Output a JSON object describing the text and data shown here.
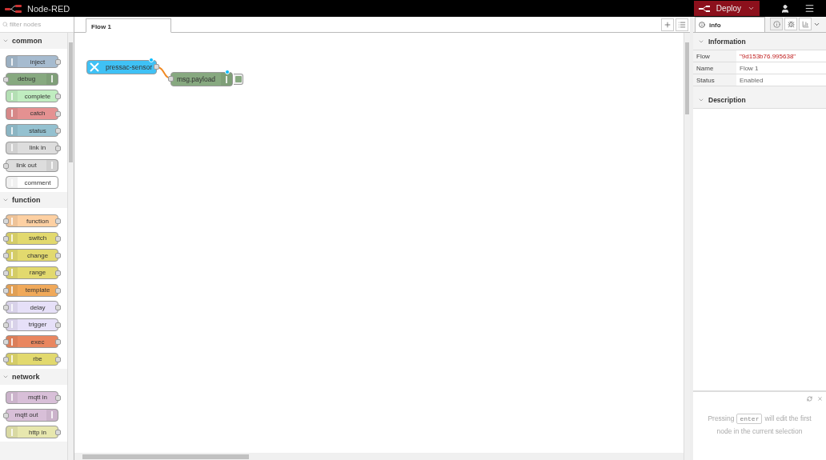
{
  "header": {
    "title": "Node-RED",
    "deploy": "Deploy"
  },
  "palette": {
    "filter_placeholder": "filter nodes",
    "categories": [
      {
        "name": "common",
        "expanded": true,
        "nodes": [
          {
            "label": "inject",
            "color": "#a6bbcf",
            "input": false,
            "output": true,
            "icon_right": false
          },
          {
            "label": "debug",
            "color": "#87a980",
            "input": true,
            "output": false,
            "icon_right": true
          },
          {
            "label": "complete",
            "color": "#c0edc0",
            "input": false,
            "output": true,
            "icon_right": false
          },
          {
            "label": "catch",
            "color": "#e49191",
            "input": false,
            "output": true,
            "icon_right": false
          },
          {
            "label": "status",
            "color": "#94c1d0",
            "input": false,
            "output": true,
            "icon_right": false
          },
          {
            "label": "link in",
            "color": "#dddddd",
            "input": false,
            "output": true,
            "icon_right": false
          },
          {
            "label": "link out",
            "color": "#dddddd",
            "input": true,
            "output": false,
            "icon_right": true
          },
          {
            "label": "comment",
            "color": "#ffffff",
            "input": false,
            "output": false,
            "icon_right": false
          }
        ]
      },
      {
        "name": "function",
        "expanded": true,
        "nodes": [
          {
            "label": "function",
            "color": "#fdd0a2",
            "input": true,
            "output": true,
            "icon_right": false
          },
          {
            "label": "switch",
            "color": "#e2d96e",
            "input": true,
            "output": true,
            "icon_right": false
          },
          {
            "label": "change",
            "color": "#e2d96e",
            "input": true,
            "output": true,
            "icon_right": false
          },
          {
            "label": "range",
            "color": "#e2d96e",
            "input": true,
            "output": true,
            "icon_right": false
          },
          {
            "label": "template",
            "color": "#f0a95a",
            "input": true,
            "output": true,
            "icon_right": false
          },
          {
            "label": "delay",
            "color": "#e6e0f8",
            "input": true,
            "output": true,
            "icon_right": false
          },
          {
            "label": "trigger",
            "color": "#e6e0f8",
            "input": true,
            "output": true,
            "icon_right": false
          },
          {
            "label": "exec",
            "color": "#e9865f",
            "input": true,
            "output": true,
            "icon_right": false
          },
          {
            "label": "rbe",
            "color": "#e2d96e",
            "input": true,
            "output": true,
            "icon_right": false
          }
        ]
      },
      {
        "name": "network",
        "expanded": true,
        "nodes": [
          {
            "label": "mqtt in",
            "color": "#d8bfd8",
            "input": false,
            "output": true,
            "icon_right": false
          },
          {
            "label": "mqtt out",
            "color": "#d8bfd8",
            "input": true,
            "output": false,
            "icon_right": true
          },
          {
            "label": "http in",
            "color": "#e7e7ae",
            "input": false,
            "output": true,
            "icon_right": false
          }
        ]
      }
    ]
  },
  "workspace": {
    "tabs": [
      {
        "label": "Flow 1",
        "selected": true
      }
    ],
    "nodes": [
      {
        "label": "pressac-sensor",
        "color": "#3fc1f5",
        "changed": true,
        "input": false,
        "output": true,
        "button": false
      },
      {
        "label": "msg.payload",
        "color": "#87a980",
        "changed": true,
        "input": true,
        "output": false,
        "button": true
      }
    ]
  },
  "sidebar": {
    "tab": "info",
    "info": {
      "heading": "Information",
      "expanded": true,
      "rows": [
        {
          "key": "Flow",
          "value": "\"9d153b76.995638\"",
          "kind": "id"
        },
        {
          "key": "Name",
          "value": "Flow 1",
          "kind": "plain"
        },
        {
          "key": "Status",
          "value": "Enabled",
          "kind": "plain"
        }
      ]
    },
    "description": {
      "heading": "Description",
      "expanded": true
    },
    "tip": {
      "before": "Pressing",
      "key": "enter",
      "after": "will edit the first",
      "line_2": "node in the current selection"
    }
  }
}
